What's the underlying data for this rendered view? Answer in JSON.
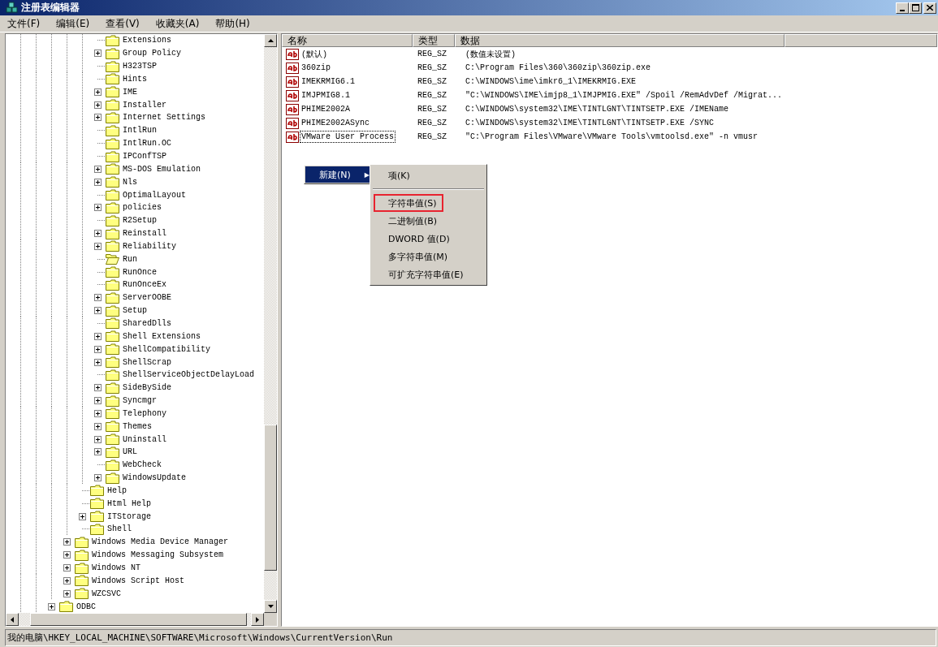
{
  "window": {
    "title": "注册表编辑器"
  },
  "menu": [
    "文件(F)",
    "编辑(E)",
    "查看(V)",
    "收藏夹(A)",
    "帮助(H)"
  ],
  "tree": {
    "items": [
      {
        "children": [
          {
            "children": [
              {
                "children": [
                  {
                    "label": "Extensions",
                    "expandable": false,
                    "open": false
                  },
                  {
                    "label": "Group Policy",
                    "expandable": true,
                    "open": false
                  },
                  {
                    "label": "H323TSP",
                    "expandable": false,
                    "open": false
                  },
                  {
                    "label": "Hints",
                    "expandable": false,
                    "open": false
                  },
                  {
                    "label": "IME",
                    "expandable": true,
                    "open": false
                  },
                  {
                    "label": "Installer",
                    "expandable": true,
                    "open": false
                  },
                  {
                    "label": "Internet Settings",
                    "expandable": true,
                    "open": false
                  },
                  {
                    "label": "IntlRun",
                    "expandable": false,
                    "open": false
                  },
                  {
                    "label": "IntlRun.OC",
                    "expandable": false,
                    "open": false
                  },
                  {
                    "label": "IPConfTSP",
                    "expandable": false,
                    "open": false
                  },
                  {
                    "label": "MS-DOS Emulation",
                    "expandable": true,
                    "open": false
                  },
                  {
                    "label": "Nls",
                    "expandable": true,
                    "open": false
                  },
                  {
                    "label": "OptimalLayout",
                    "expandable": false,
                    "open": false
                  },
                  {
                    "label": "policies",
                    "expandable": true,
                    "open": false
                  },
                  {
                    "label": "R2Setup",
                    "expandable": false,
                    "open": false
                  },
                  {
                    "label": "Reinstall",
                    "expandable": true,
                    "open": false
                  },
                  {
                    "label": "Reliability",
                    "expandable": true,
                    "open": false
                  },
                  {
                    "label": "Run",
                    "expandable": false,
                    "open": true
                  },
                  {
                    "label": "RunOnce",
                    "expandable": false,
                    "open": false
                  },
                  {
                    "label": "RunOnceEx",
                    "expandable": false,
                    "open": false
                  },
                  {
                    "label": "ServerOOBE",
                    "expandable": true,
                    "open": false
                  },
                  {
                    "label": "Setup",
                    "expandable": true,
                    "open": false
                  },
                  {
                    "label": "SharedDlls",
                    "expandable": false,
                    "open": false
                  },
                  {
                    "label": "Shell Extensions",
                    "expandable": true,
                    "open": false
                  },
                  {
                    "label": "ShellCompatibility",
                    "expandable": true,
                    "open": false
                  },
                  {
                    "label": "ShellScrap",
                    "expandable": true,
                    "open": false
                  },
                  {
                    "label": "ShellServiceObjectDelayLoad",
                    "expandable": false,
                    "open": false
                  },
                  {
                    "label": "SideBySide",
                    "expandable": true,
                    "open": false
                  },
                  {
                    "label": "Syncmgr",
                    "expandable": true,
                    "open": false
                  },
                  {
                    "label": "Telephony",
                    "expandable": true,
                    "open": false
                  },
                  {
                    "label": "Themes",
                    "expandable": true,
                    "open": false
                  },
                  {
                    "label": "Uninstall",
                    "expandable": true,
                    "open": false
                  },
                  {
                    "label": "URL",
                    "expandable": true,
                    "open": false
                  },
                  {
                    "label": "WebCheck",
                    "expandable": false,
                    "open": false
                  },
                  {
                    "label": "WindowsUpdate",
                    "expandable": true,
                    "open": false
                  }
                ]
              },
              {
                "label": "Help",
                "expandable": false,
                "open": false
              },
              {
                "label": "Html Help",
                "expandable": false,
                "open": false
              },
              {
                "label": "ITStorage",
                "expandable": true,
                "open": false
              },
              {
                "label": "Shell",
                "expandable": false,
                "open": false
              }
            ]
          },
          {
            "label": "Windows Media Device Manager",
            "expandable": true,
            "open": false
          },
          {
            "label": "Windows Messaging Subsystem",
            "expandable": true,
            "open": false
          },
          {
            "label": "Windows NT",
            "expandable": true,
            "open": false
          },
          {
            "label": "Windows Script Host",
            "expandable": true,
            "open": false
          },
          {
            "label": "WZCSVC",
            "expandable": true,
            "open": false
          }
        ]
      },
      {
        "label": "ODBC",
        "expandable": true,
        "open": false
      }
    ]
  },
  "table": {
    "columns": [
      "名称",
      "类型",
      "数据"
    ],
    "rows": [
      {
        "name": "(默认)",
        "type": "REG_SZ",
        "data": "(数值未设置)",
        "focused": false
      },
      {
        "name": "360zip",
        "type": "REG_SZ",
        "data": "C:\\Program Files\\360\\360zip\\360zip.exe",
        "focused": false
      },
      {
        "name": "IMEKRMIG6.1",
        "type": "REG_SZ",
        "data": "C:\\WINDOWS\\ime\\imkr6_1\\IMEKRMIG.EXE",
        "focused": false
      },
      {
        "name": "IMJPMIG8.1",
        "type": "REG_SZ",
        "data": "\"C:\\WINDOWS\\IME\\imjp8_1\\IMJPMIG.EXE\" /Spoil /RemAdvDef /Migrat...",
        "focused": false
      },
      {
        "name": "PHIME2002A",
        "type": "REG_SZ",
        "data": "C:\\WINDOWS\\system32\\IME\\TINTLGNT\\TINTSETP.EXE /IMEName",
        "focused": false
      },
      {
        "name": "PHIME2002ASync",
        "type": "REG_SZ",
        "data": "C:\\WINDOWS\\system32\\IME\\TINTLGNT\\TINTSETP.EXE /SYNC",
        "focused": false
      },
      {
        "name": "VMware User Process",
        "type": "REG_SZ",
        "data": "\"C:\\Program Files\\VMware\\VMware Tools\\vmtoolsd.exe\" -n vmusr",
        "focused": true
      }
    ]
  },
  "context_menu": {
    "items": [
      {
        "label": "新建(N)",
        "selected": true,
        "arrow": "▶"
      }
    ]
  },
  "submenu": {
    "items": [
      {
        "kind": "item",
        "label": "项(K)",
        "annotated": false
      },
      {
        "kind": "separator"
      },
      {
        "kind": "item",
        "label": "字符串值(S)",
        "annotated": true
      },
      {
        "kind": "item",
        "label": "二进制值(B)",
        "annotated": false
      },
      {
        "kind": "item",
        "label": "DWORD 值(D)",
        "annotated": false
      },
      {
        "kind": "item",
        "label": "多字符串值(M)",
        "annotated": false
      },
      {
        "kind": "item",
        "label": "可扩充字符串值(E)",
        "annotated": false
      }
    ]
  },
  "status_bar": "我的电脑\\HKEY_LOCAL_MACHINE\\SOFTWARE\\Microsoft\\Windows\\CurrentVersion\\Run"
}
